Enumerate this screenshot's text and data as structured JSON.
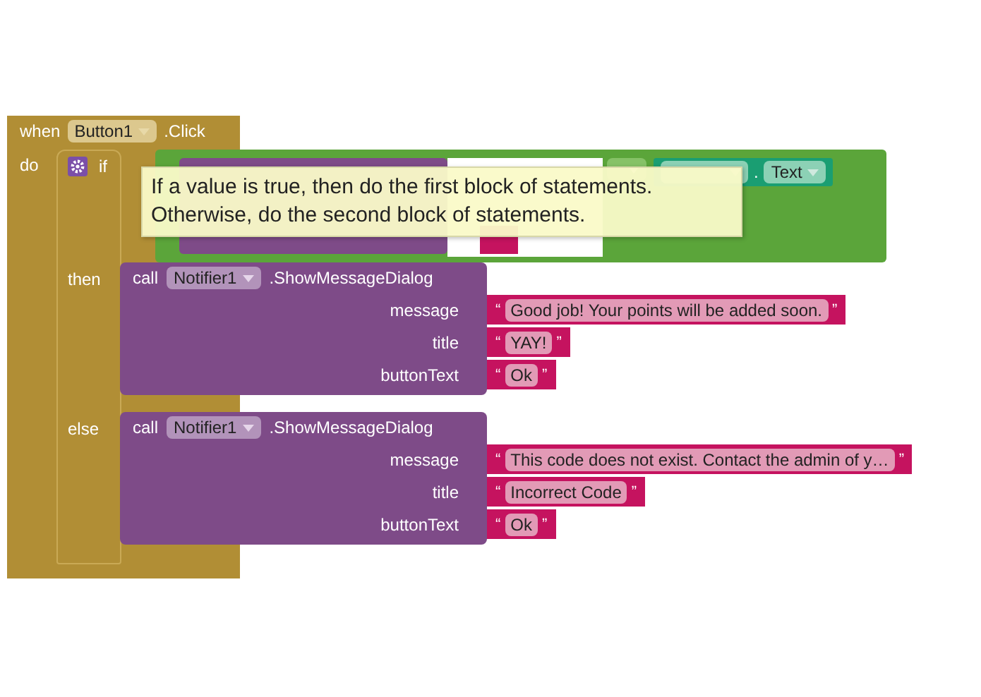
{
  "event": {
    "keyword": "when",
    "component": "Button1",
    "event": ".Click",
    "do_label": "do"
  },
  "if_block": {
    "if_label": "if",
    "then_label": "then",
    "else_label": "else"
  },
  "condition": {
    "dot": ".",
    "property": "Text"
  },
  "tooltip": {
    "text": "If a value is true, then do the first block of statements.\nOtherwise, do the second block of statements."
  },
  "branches": [
    {
      "call": "call",
      "component": "Notifier1",
      "method": ".ShowMessageDialog",
      "args": [
        {
          "name": "message",
          "open": "“",
          "value": "Good job! Your points will be added soon.",
          "close": "”"
        },
        {
          "name": "title",
          "open": "“",
          "value": "YAY!",
          "close": "”"
        },
        {
          "name": "buttonText",
          "open": "“",
          "value": "Ok",
          "close": "”"
        }
      ]
    },
    {
      "call": "call",
      "component": "Notifier1",
      "method": ".ShowMessageDialog",
      "args": [
        {
          "name": "message",
          "open": "“",
          "value": "This code does not exist. Contact the admin of y…",
          "close": "”"
        },
        {
          "name": "title",
          "open": "“",
          "value": "Incorrect Code",
          "close": "”"
        },
        {
          "name": "buttonText",
          "open": "“",
          "value": "Ok",
          "close": "”"
        }
      ]
    }
  ]
}
